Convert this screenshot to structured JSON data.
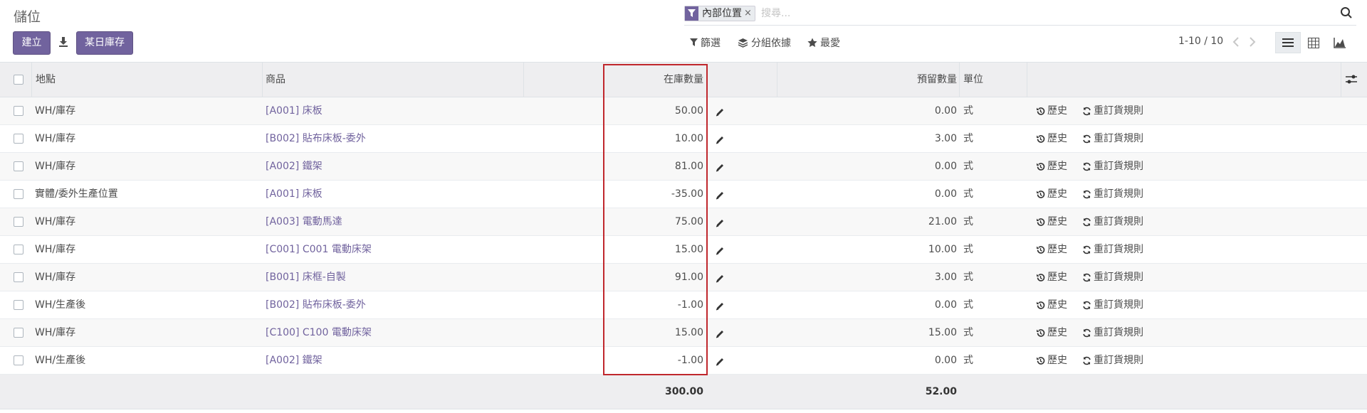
{
  "header": {
    "title": "儲位",
    "create_label": "建立",
    "date_inventory_label": "某日庫存"
  },
  "search": {
    "facet_value": "內部位置",
    "facet_remove": "×",
    "placeholder": "搜尋..."
  },
  "toolbar": {
    "filters_label": "篩選",
    "groupby_label": "分組依據",
    "favorites_label": "最愛",
    "pager_text": "1-10 / 10"
  },
  "table": {
    "columns": {
      "location": "地點",
      "product": "商品",
      "on_hand": "在庫數量",
      "reserved": "預留數量",
      "uom": "單位"
    },
    "history_label": "歷史",
    "reorder_label": "重訂貨規則",
    "rows": [
      {
        "location": "WH/庫存",
        "product": "[A001] 床板",
        "on_hand": "50.00",
        "reserved": "0.00",
        "uom": "式"
      },
      {
        "location": "WH/庫存",
        "product": "[B002] 貼布床板-委外",
        "on_hand": "10.00",
        "reserved": "3.00",
        "uom": "式"
      },
      {
        "location": "WH/庫存",
        "product": "[A002] 鐵架",
        "on_hand": "81.00",
        "reserved": "0.00",
        "uom": "式"
      },
      {
        "location": "實體/委外生產位置",
        "product": "[A001] 床板",
        "on_hand": "-35.00",
        "reserved": "0.00",
        "uom": "式"
      },
      {
        "location": "WH/庫存",
        "product": "[A003] 電動馬達",
        "on_hand": "75.00",
        "reserved": "21.00",
        "uom": "式"
      },
      {
        "location": "WH/庫存",
        "product": "[C001] C001 電動床架",
        "on_hand": "15.00",
        "reserved": "10.00",
        "uom": "式"
      },
      {
        "location": "WH/庫存",
        "product": "[B001] 床框-自製",
        "on_hand": "91.00",
        "reserved": "3.00",
        "uom": "式"
      },
      {
        "location": "WH/生產後",
        "product": "[B002] 貼布床板-委外",
        "on_hand": "-1.00",
        "reserved": "0.00",
        "uom": "式"
      },
      {
        "location": "WH/庫存",
        "product": "[C100] C100 電動床架",
        "on_hand": "15.00",
        "reserved": "15.00",
        "uom": "式"
      },
      {
        "location": "WH/生產後",
        "product": "[A002] 鐵架",
        "on_hand": "-1.00",
        "reserved": "0.00",
        "uom": "式"
      }
    ],
    "totals": {
      "on_hand": "300.00",
      "reserved": "52.00"
    }
  },
  "colors": {
    "brand": "#71639e",
    "highlight": "#c0272d"
  }
}
